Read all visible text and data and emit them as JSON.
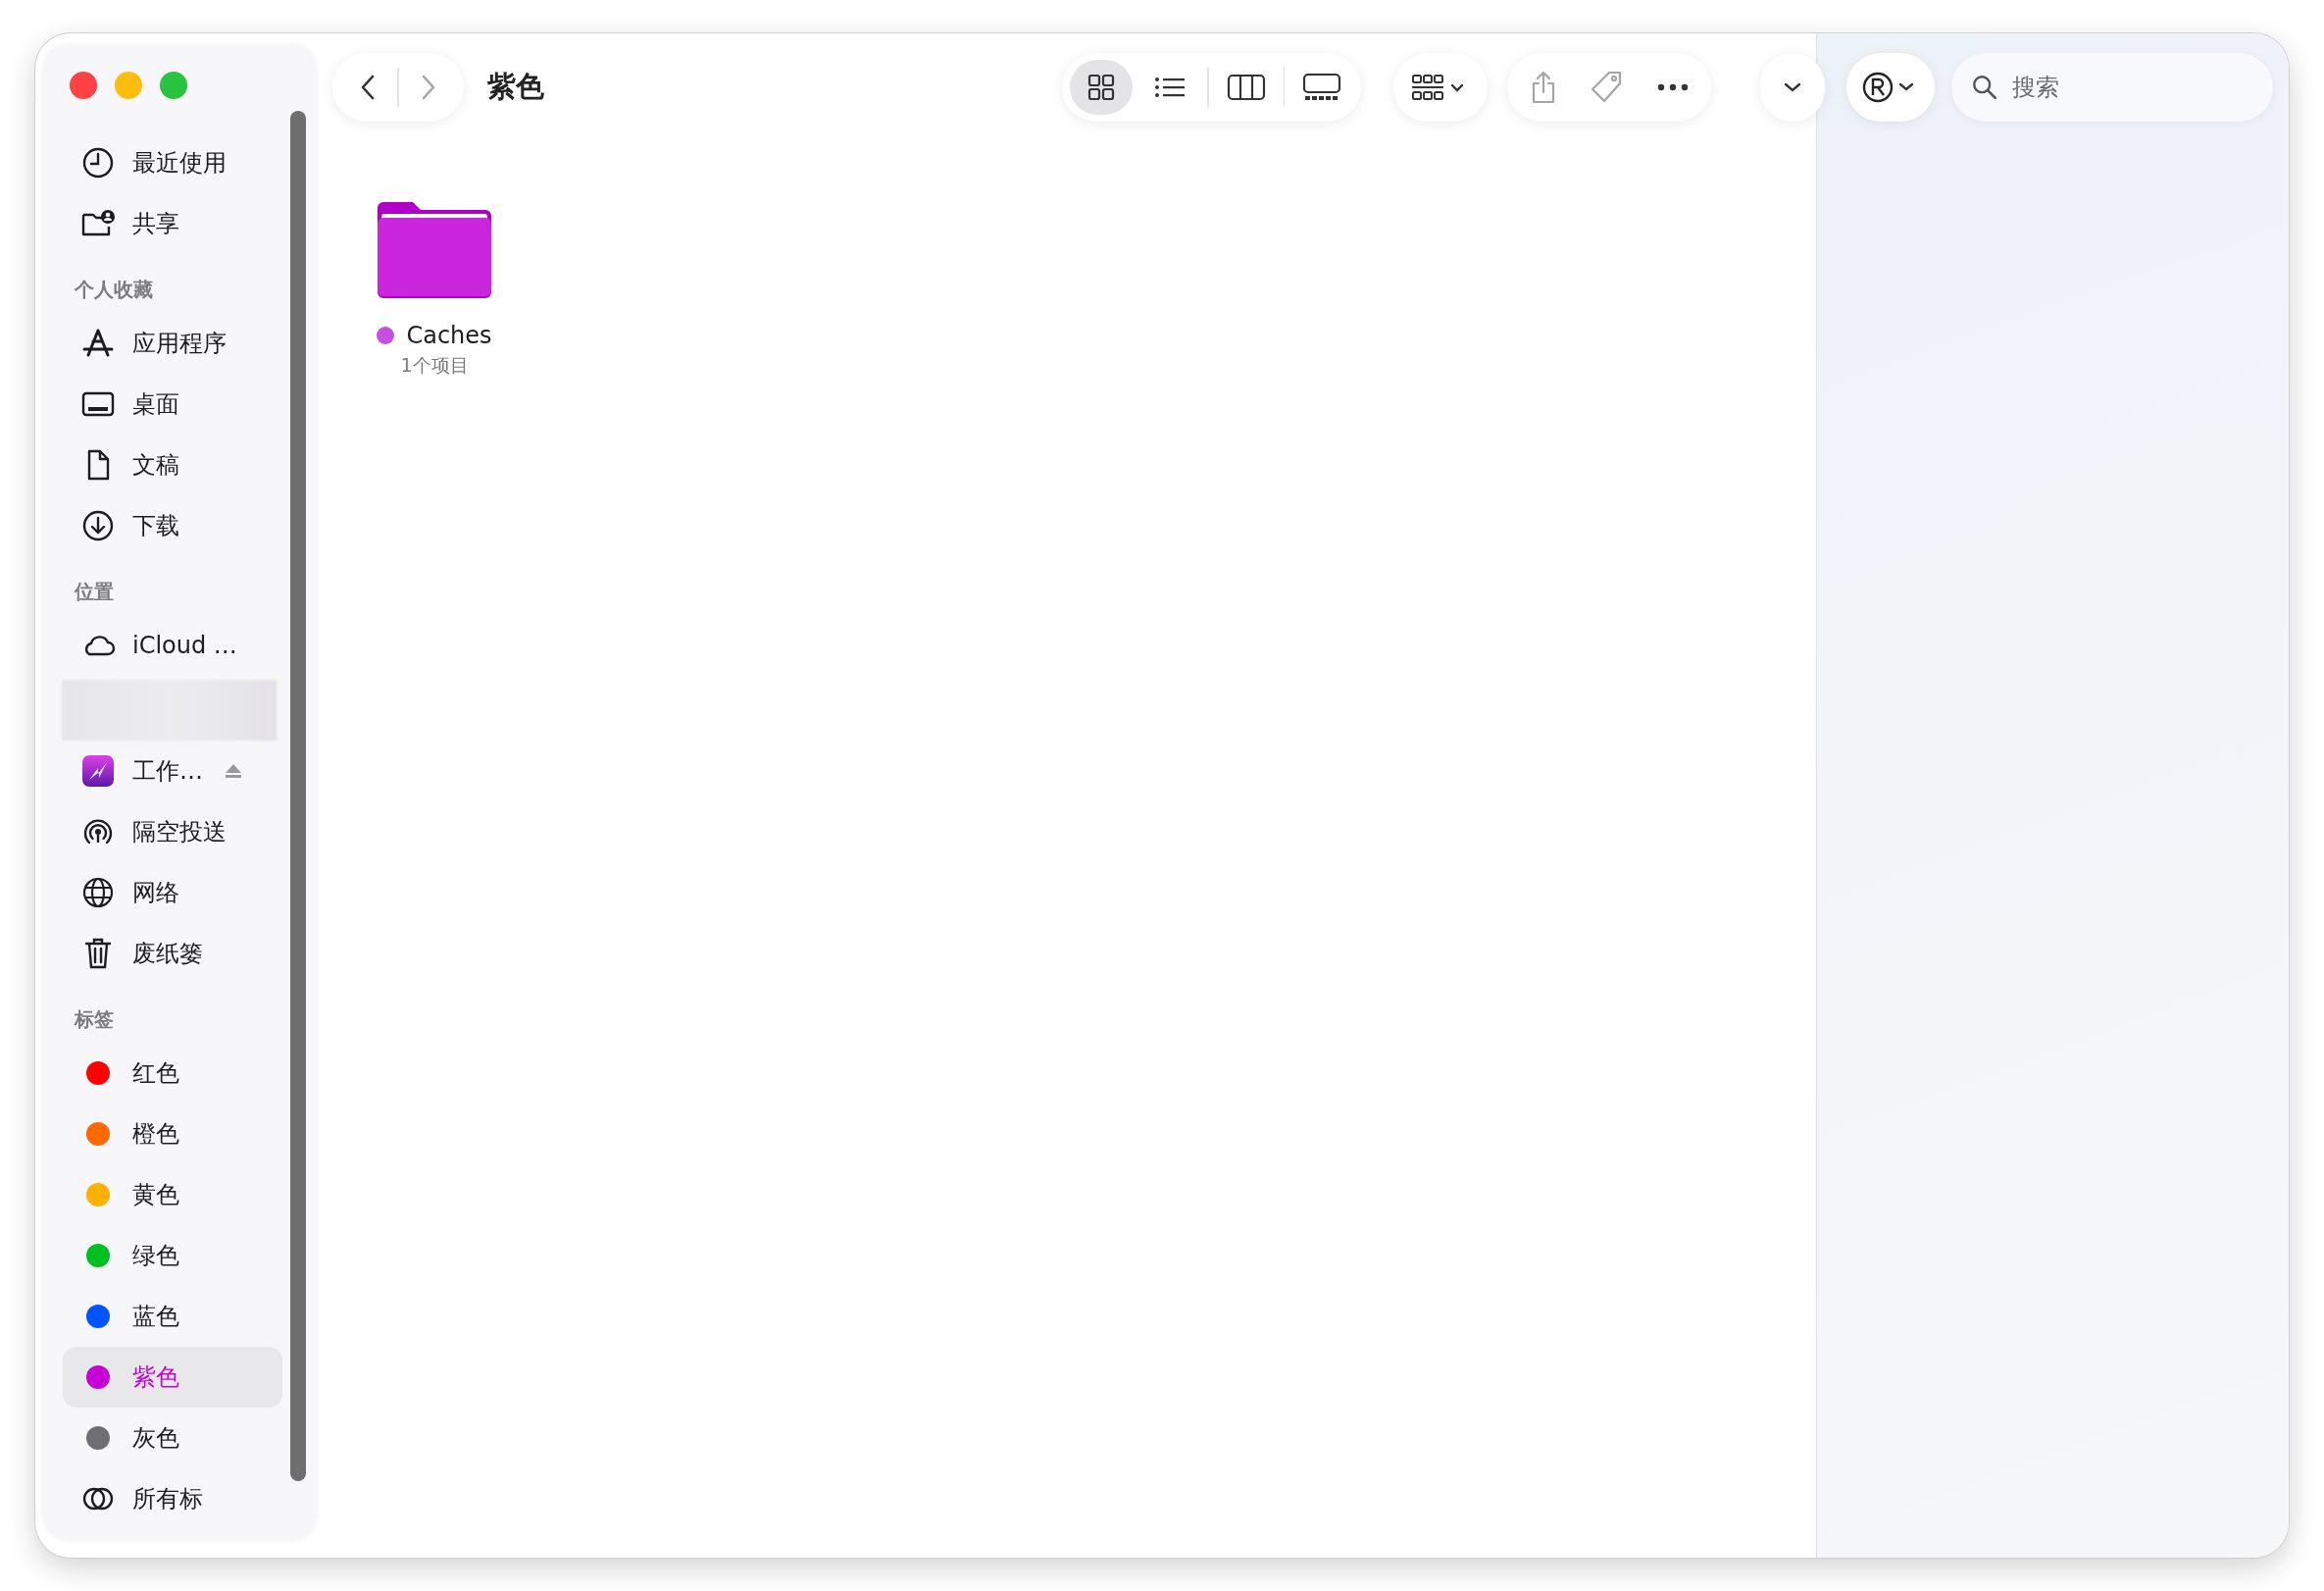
{
  "window": {
    "title": "紫色"
  },
  "sidebar": {
    "sections": [
      {
        "items": [
          {
            "kind": "item",
            "label": "最近使用",
            "selected": false
          },
          {
            "kind": "item",
            "label": "共享",
            "selected": false
          }
        ]
      },
      {
        "heading": "个人收藏",
        "items": [
          {
            "kind": "item",
            "label": "应用程序",
            "selected": false
          },
          {
            "kind": "item",
            "label": "桌面",
            "selected": false
          },
          {
            "kind": "item",
            "label": "文稿",
            "selected": false
          },
          {
            "kind": "item",
            "label": "下载",
            "selected": false
          }
        ]
      },
      {
        "heading": "位置",
        "items": [
          {
            "kind": "item",
            "label": "iCloud …",
            "selected": false
          },
          {
            "kind": "blurred"
          },
          {
            "kind": "item",
            "label": "工作…",
            "ejectable": true,
            "selected": false
          },
          {
            "kind": "item",
            "label": "隔空投送",
            "selected": false
          },
          {
            "kind": "item",
            "label": "网络",
            "selected": false
          },
          {
            "kind": "item",
            "label": "废纸篓",
            "selected": false
          }
        ]
      },
      {
        "heading": "标签",
        "items": [
          {
            "kind": "tag",
            "label": "红色",
            "color": "#fe0000",
            "selected": false
          },
          {
            "kind": "tag",
            "label": "橙色",
            "color": "#ff6a00",
            "selected": false
          },
          {
            "kind": "tag",
            "label": "黄色",
            "color": "#ffb000",
            "selected": false
          },
          {
            "kind": "tag",
            "label": "绿色",
            "color": "#00c020",
            "selected": false
          },
          {
            "kind": "tag",
            "label": "蓝色",
            "color": "#0055ff",
            "selected": false
          },
          {
            "kind": "tag",
            "label": "紫色",
            "color": "#c800d8",
            "selected": true
          },
          {
            "kind": "tag",
            "label": "灰色",
            "color": "#6e6e73",
            "selected": false
          },
          {
            "kind": "alltags",
            "label": "所有标",
            "selected": false
          }
        ]
      }
    ]
  },
  "toolbar": {
    "back_enabled": true,
    "forward_enabled": false,
    "views": [
      {
        "selected": true
      },
      {
        "selected": false
      },
      {
        "selected": false
      },
      {
        "selected": false
      }
    ],
    "share_enabled": false,
    "search": {
      "placeholder": "搜索"
    }
  },
  "files": [
    {
      "name": "Caches",
      "color": "#c44fe0",
      "info": "1个项目"
    }
  ]
}
